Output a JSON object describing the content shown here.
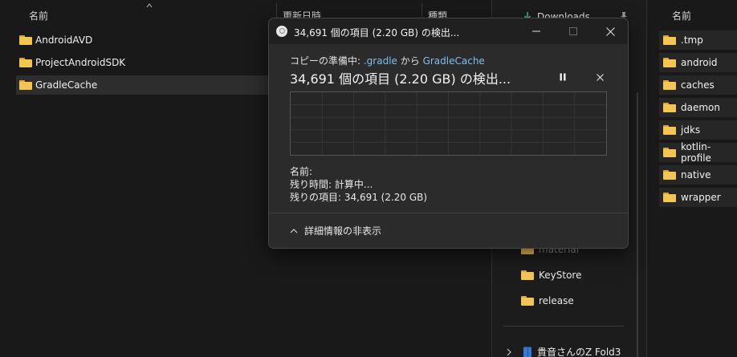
{
  "left_pane": {
    "columns": {
      "name": "名前",
      "modified": "更新日時",
      "type": "種類"
    },
    "rows": [
      {
        "name": "AndroidAVD",
        "selected": false
      },
      {
        "name": "ProjectAndroidSDK",
        "selected": false
      },
      {
        "name": "GradleCache",
        "selected": true
      }
    ]
  },
  "nav_pane": {
    "downloads": "Downloads",
    "folders": [
      "material",
      "KeyStore",
      "release"
    ],
    "device": "貴音さんのZ Fold3"
  },
  "right_pane": {
    "column_name": "名前",
    "folders": [
      ".tmp",
      "android",
      "caches",
      "daemon",
      "jdks",
      "kotlin-profile",
      "native",
      "wrapper"
    ]
  },
  "dialog": {
    "title": "34,691 個の項目 (2.20 GB) の検出...",
    "copy_prefix": "コピーの準備中: ",
    "source": ".gradle",
    "connector": " から ",
    "destination": "GradleCache",
    "status": "34,691 個の項目 (2.20 GB) の検出...",
    "name_label": "名前:",
    "time_remaining": "残り時間:  計算中...",
    "items_remaining": "残りの項目: 34,691 (2.20 GB)",
    "details_toggle": "詳細情報の非表示",
    "accent_link_color": "#7cc0ef"
  },
  "icons": {
    "folder": "folder-icon",
    "download": "download-icon",
    "pin": "pin-icon",
    "pause": "pause-icon",
    "cancel": "close-icon",
    "chevron_up": "chevron-up-icon"
  }
}
